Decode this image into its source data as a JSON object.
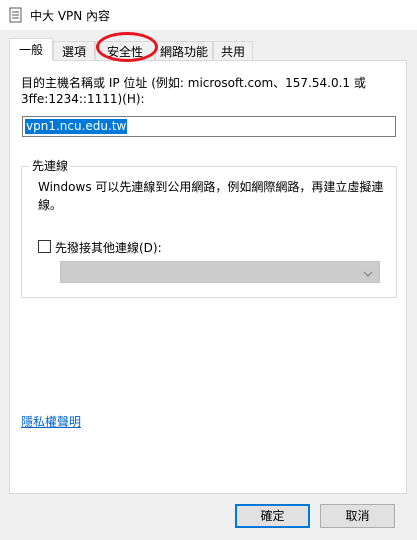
{
  "window": {
    "title": "中大 VPN 內容"
  },
  "tabs": [
    {
      "label": "一般",
      "active": true
    },
    {
      "label": "選項",
      "active": false
    },
    {
      "label": "安全性",
      "active": false
    },
    {
      "label": "網路功能",
      "active": false
    },
    {
      "label": "共用",
      "active": false
    }
  ],
  "general": {
    "host_label": "目的主機名稱或 IP 位址 (例如: microsoft.com、157.54.0.1 或 3ffe:1234::1111)(H):",
    "host_value": "vpn1.ncu.edu.tw",
    "first_connect": {
      "legend": "先連線",
      "description": "Windows 可以先連線到公用網路，例如網際網路，再建立虛擬連線。",
      "checkbox_label": "先撥接其他連線(D):",
      "checkbox_checked": false,
      "select_value": ""
    },
    "privacy_link": "隱私權聲明"
  },
  "buttons": {
    "ok": "確定",
    "cancel": "取消"
  },
  "colors": {
    "selection": "#0078d7",
    "link": "#0066cc",
    "annotation": "#e8141e"
  },
  "icons": [
    "vpn-document-icon",
    "dropdown-arrow-icon"
  ]
}
